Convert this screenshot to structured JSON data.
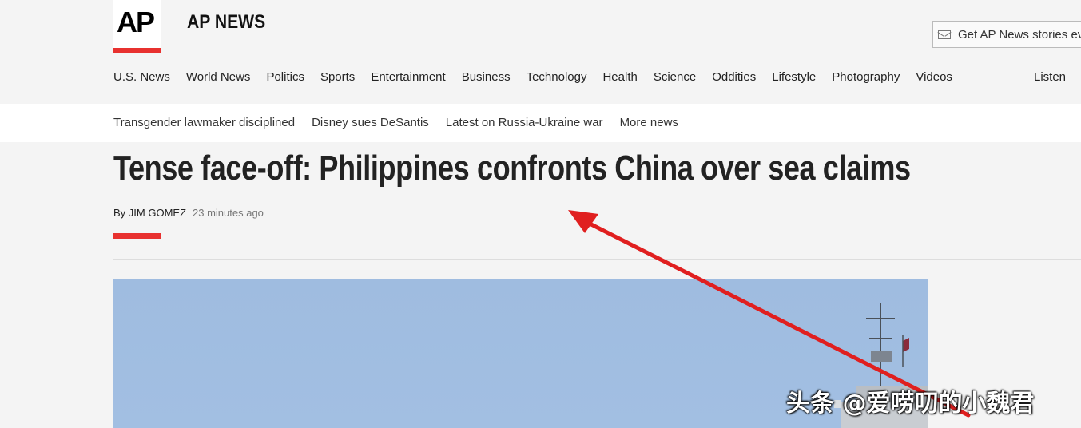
{
  "header": {
    "logo_text": "AP",
    "site_name": "AP NEWS",
    "newsletter_label": "Get AP News stories eve",
    "listen_label": "Listen"
  },
  "nav": {
    "items": [
      "U.S. News",
      "World News",
      "Politics",
      "Sports",
      "Entertainment",
      "Business",
      "Technology",
      "Health",
      "Science",
      "Oddities",
      "Lifestyle",
      "Photography",
      "Videos"
    ]
  },
  "trending": {
    "items": [
      "Transgender lawmaker disciplined",
      "Disney sues DeSantis",
      "Latest on Russia-Ukraine war",
      "More news"
    ]
  },
  "article": {
    "headline": "Tense face-off: Philippines confronts China over sea claims",
    "byline_prefix": "By ",
    "author": "JIM GOMEZ",
    "timestamp": "23 minutes ago"
  },
  "watermark": "头条 @爱唠叨的小魏君",
  "colors": {
    "accent": "#e8312f",
    "annotation": "#e01f1f",
    "sky": "#a0bde0"
  }
}
